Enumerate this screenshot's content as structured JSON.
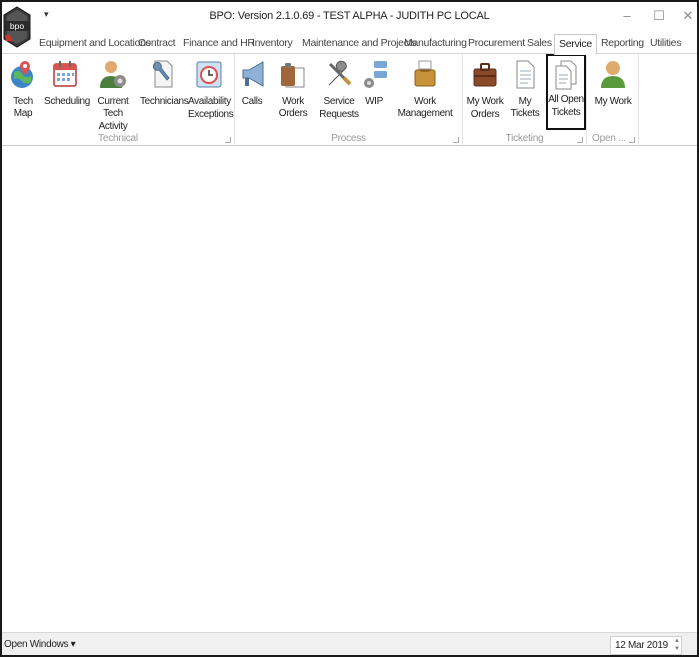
{
  "window": {
    "title": "BPO: Version 2.1.0.69 - TEST ALPHA - JUDITH PC LOCAL",
    "logo_text": "bpo",
    "qat": "▾",
    "controls": {
      "minimize": "–",
      "maximize": "☐",
      "close": "✕"
    }
  },
  "tabs": [
    {
      "label": "Equipment and Locations"
    },
    {
      "label": "Contract"
    },
    {
      "label": "Finance and HR"
    },
    {
      "label": "Inventory"
    },
    {
      "label": "Maintenance and Projects"
    },
    {
      "label": "Manufacturing"
    },
    {
      "label": "Procurement"
    },
    {
      "label": "Sales"
    },
    {
      "label": "Service",
      "active": true
    },
    {
      "label": "Reporting"
    },
    {
      "label": "Utilities"
    }
  ],
  "ribbon": {
    "groups": {
      "technical": {
        "label": "Technical",
        "buttons": {
          "tech_map": {
            "line1": "Tech Map",
            "line2": "",
            "icon": "globe-pin-icon"
          },
          "scheduling": {
            "line1": "Scheduling",
            "line2": "",
            "icon": "calendar-icon"
          },
          "current_tech_activity": {
            "line1": "Current Tech",
            "line2": "Activity",
            "icon": "person-gear-icon"
          },
          "technicians": {
            "line1": "Technicians",
            "line2": "",
            "icon": "wrench-document-icon"
          },
          "availability_exceptions": {
            "line1": "Availability",
            "line2": "Exceptions",
            "icon": "clock-calendar-icon"
          }
        }
      },
      "process": {
        "label": "Process",
        "buttons": {
          "calls": {
            "line1": "Calls",
            "line2": "",
            "icon": "megaphone-icon"
          },
          "work_orders": {
            "line1": "Work Orders",
            "line2": "",
            "icon": "clipboard-icon"
          },
          "service_requests": {
            "line1": "Service",
            "line2": "Requests",
            "icon": "tools-icon"
          },
          "wip": {
            "line1": "WIP",
            "line2": "",
            "icon": "workflow-icon"
          },
          "work_management": {
            "line1": "Work Management",
            "line2": "",
            "icon": "briefcase-clipboard-icon"
          }
        }
      },
      "ticketing": {
        "label": "Ticketing",
        "buttons": {
          "my_work_orders": {
            "line1": "My Work",
            "line2": "Orders",
            "icon": "briefcase-icon"
          },
          "my_tickets": {
            "line1": "My Tickets",
            "line2": "",
            "icon": "document-icon"
          },
          "all_open_tickets": {
            "line1": "All Open",
            "line2": "Tickets",
            "icon": "documents-icon"
          }
        }
      },
      "open": {
        "label": "Open ...",
        "buttons": {
          "my_work": {
            "line1": "My Work",
            "line2": "",
            "icon": "user-icon"
          }
        }
      }
    }
  },
  "statusbar": {
    "open_windows": "Open Windows ▾",
    "date": "12 Mar 2019"
  },
  "colors": {
    "frame": "#1a1a1a",
    "highlight_border": "#111111",
    "group_label": "#9a9a9a",
    "statusbar_bg": "#f0f0f0"
  }
}
